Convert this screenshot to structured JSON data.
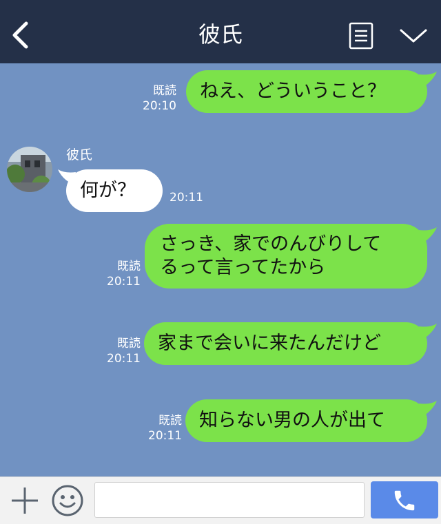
{
  "header": {
    "title": "彼氏",
    "back_icon": "chevron-left-icon",
    "menu_icon": "list-menu-icon",
    "collapse_icon": "chevron-down-icon"
  },
  "contact": {
    "name": "彼氏",
    "avatar_icon": "avatar-photo"
  },
  "messages": [
    {
      "sender": "me",
      "text": "ねえ、どういうこと？",
      "read_label": "既読",
      "time": "20:10"
    },
    {
      "sender": "them",
      "text": "何が？",
      "time": "20:11"
    },
    {
      "sender": "me",
      "line1": "さっき、家でのんびりして",
      "line2": "るって言ってたから",
      "read_label": "既読",
      "time": "20:11"
    },
    {
      "sender": "me",
      "text": "家まで会いに来たんだけど",
      "read_label": "既読",
      "time": "20:11"
    },
    {
      "sender": "me",
      "text": "知らない男の人が出て",
      "read_label": "既読",
      "time": "20:11"
    }
  ],
  "input_bar": {
    "plus_icon": "plus-icon",
    "emoji_icon": "smile-icon",
    "placeholder": "",
    "call_icon": "phone-icon"
  },
  "colors": {
    "header_bg": "#243048",
    "chat_bg": "#7192c2",
    "my_bubble": "#7ce24a",
    "their_bubble": "#ffffff",
    "call_button": "#5a8ae8"
  }
}
